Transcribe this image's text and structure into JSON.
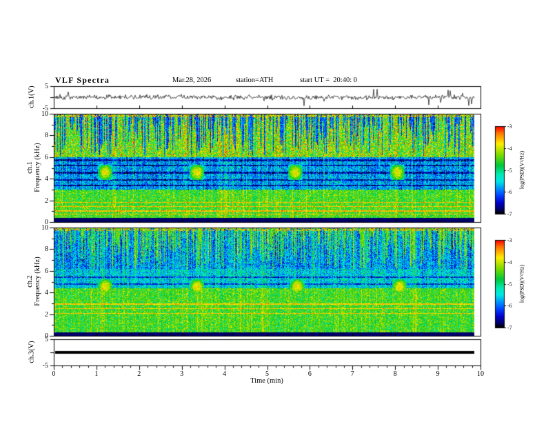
{
  "header": {
    "title": "VLF Spectra",
    "date": "Mar.28, 2026",
    "station": "station=ATH",
    "start_ut": "start UT =  20:40: 0"
  },
  "chart_data": {
    "type": "heatmap",
    "title": "VLF Spectra",
    "subtitle": "Mar.28, 2026  station=ATH  start UT = 20:40:0",
    "xlabel": "Time (min)",
    "x_range": [
      0,
      10
    ],
    "x_ticks": [
      "0",
      "1",
      "2",
      "3",
      "4",
      "5",
      "6",
      "7",
      "8",
      "9",
      "10"
    ],
    "x_minor_step": 0.2,
    "data_end_min": 9.85,
    "colormap_range": [
      -7,
      -3
    ],
    "panels": [
      {
        "id": "ch1-waveform",
        "kind": "waveform",
        "ylabel": "ch.1(V)",
        "y_range": [
          -5,
          5
        ],
        "y_tick_values": [
          5,
          -5
        ],
        "y_tick_labels": [
          "5",
          "-5"
        ],
        "noise_amp": 1.05,
        "spike_prob": 0.02,
        "seed": 1337
      },
      {
        "id": "ch1-spectrogram",
        "kind": "spectrogram",
        "ylabel_channel": "ch.1",
        "ylabel_axis": "Frequency (kHz)",
        "y_range": [
          0,
          10
        ],
        "y_tick_values": [
          0,
          2,
          4,
          6,
          8,
          10
        ],
        "y_tick_labels": [
          "0",
          "2",
          "4",
          "6",
          "8",
          "10"
        ],
        "seed": 20260328,
        "model": {
          "black_below": 0.35,
          "green_band_top": 3.0,
          "green_level": -4.55,
          "orange_lines": [
            0.7,
            1.0,
            1.4,
            1.8
          ],
          "orange_level": -3.6,
          "mid_level": -5.8,
          "dark_lines": [
            3.35,
            3.9,
            4.55,
            5.2,
            5.7
          ],
          "top_band_start": 6.0,
          "top_level": -4.35,
          "top_noise": 1.2,
          "streak_prob": 0.5,
          "streak_level": -6.1,
          "blob_times": [
            1.2,
            3.35,
            5.65,
            8.05
          ],
          "blob_freq": [
            3.85,
            5.3
          ],
          "blob_level": -3.85,
          "blob_halfwidth": 0.17
        }
      },
      {
        "id": "ch2-spectrogram",
        "kind": "spectrogram",
        "ylabel_channel": "ch.2",
        "ylabel_axis": "Frequency (kHz)",
        "y_range": [
          0,
          10
        ],
        "y_tick_values": [
          0,
          2,
          4,
          6,
          8,
          10
        ],
        "y_tick_labels": [
          "0",
          "2",
          "4",
          "6",
          "8",
          "10"
        ],
        "seed": 777,
        "model": {
          "black_below": 0.3,
          "green_band_top": 4.4,
          "green_level": -4.55,
          "orange_lines": [
            2.05,
            2.5,
            2.9
          ],
          "orange_level": -3.7,
          "mid_level": -5.5,
          "dark_lines": [
            4.8,
            5.4
          ],
          "top_band_start": 6.2,
          "top_level": -5.8,
          "top_noise": 1.0,
          "streak_prob": 0.5,
          "streak_level": -4.4,
          "blob_times": [
            1.2,
            3.35,
            5.7,
            8.1
          ],
          "blob_freq": [
            3.85,
            5.2
          ],
          "blob_level": -3.8,
          "blob_halfwidth": 0.17
        }
      },
      {
        "id": "ch3-flatline",
        "kind": "flatline",
        "ylabel": "ch.3(V)",
        "y_range": [
          -5,
          5
        ],
        "y_tick_values": [
          5,
          -5
        ],
        "y_tick_labels": [
          "5",
          "-5"
        ],
        "line_value": 0
      }
    ],
    "colorbar": {
      "label": "log(PSD)(V²/Hz)",
      "tick_values": [
        -3,
        -4,
        -5,
        -6,
        -7
      ],
      "tick_labels": [
        "-3",
        "-4",
        "-5",
        "-6",
        "-7"
      ],
      "range_top": -3,
      "range_bottom": -7,
      "stops": [
        [
          0.0,
          "#ff0000"
        ],
        [
          0.08,
          "#ff7800"
        ],
        [
          0.2,
          "#ffee00"
        ],
        [
          0.33,
          "#78dc00"
        ],
        [
          0.45,
          "#00c83c"
        ],
        [
          0.55,
          "#00ebb4"
        ],
        [
          0.63,
          "#00e6e6"
        ],
        [
          0.72,
          "#008cff"
        ],
        [
          0.8,
          "#003cff"
        ],
        [
          0.88,
          "#0000c8"
        ],
        [
          0.95,
          "#00006e"
        ],
        [
          1.0,
          "#000000"
        ]
      ]
    }
  }
}
